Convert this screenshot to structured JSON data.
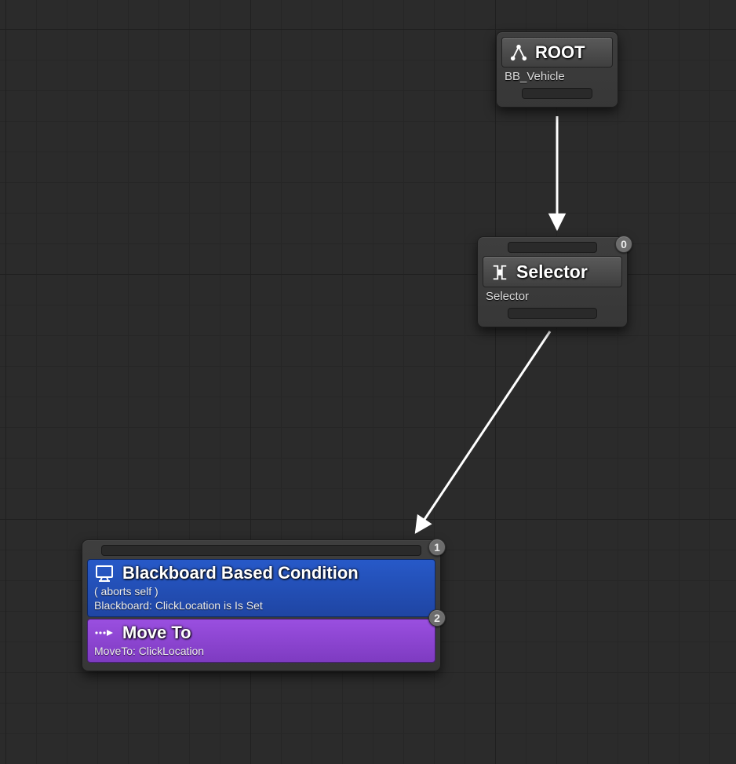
{
  "root": {
    "title": "ROOT",
    "subtitle": "BB_Vehicle"
  },
  "selector": {
    "title": "Selector",
    "subtitle": "Selector",
    "index": "0"
  },
  "task": {
    "decorator": {
      "title": "Blackboard Based Condition",
      "aborts": "( aborts self )",
      "detail": "Blackboard: ClickLocation is Is Set"
    },
    "action": {
      "title": "Move To",
      "detail": "MoveTo: ClickLocation"
    },
    "index1": "1",
    "index2": "2"
  }
}
